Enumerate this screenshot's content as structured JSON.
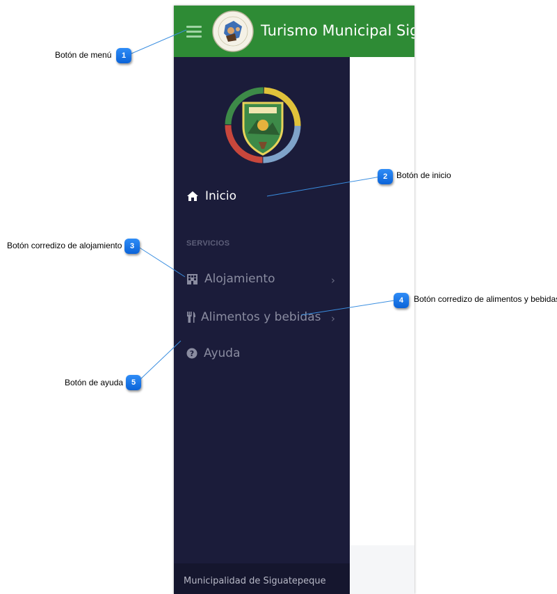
{
  "header": {
    "title": "Turismo Municipal Sigu",
    "menu_icon": "hamburger-menu-icon",
    "logo": "municipal-tourism-seal-logo",
    "color": "#2e8b35"
  },
  "drawer": {
    "logo": "siguatepeque-coat-of-arms-logo",
    "background": "#1b1c3a",
    "home": {
      "label": "Inicio",
      "icon": "home-icon"
    },
    "section_label": "SERVICIOS",
    "items": [
      {
        "label": "Alojamiento",
        "icon": "building-icon",
        "chevron": "›"
      },
      {
        "label": "Alimentos y bebidas",
        "icon": "utensils-icon",
        "chevron": "›"
      },
      {
        "label": "Ayuda",
        "icon": "question-circle-icon"
      }
    ],
    "footer": "Municipalidad de Siguatepeque"
  },
  "callouts": [
    {
      "number": "1",
      "label": "Botón de menú"
    },
    {
      "number": "2",
      "label": "Botón de inicio"
    },
    {
      "number": "3",
      "label": "Botón corredizo de alojamiento"
    },
    {
      "number": "4",
      "label": "Botón corredizo de alimentos y bebidas"
    },
    {
      "number": "5",
      "label": "Botón de ayuda"
    }
  ]
}
